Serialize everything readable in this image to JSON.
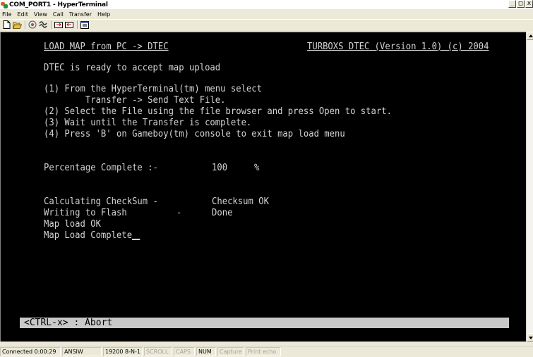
{
  "window": {
    "title": "COM_PORT1 - HyperTerminal",
    "buttons": {
      "minimize": "_",
      "maximize": "□",
      "close": "x"
    }
  },
  "menu": [
    "File",
    "Edit",
    "View",
    "Call",
    "Transfer",
    "Help"
  ],
  "toolbar": [
    "new-icon",
    "open-icon",
    "connect-icon",
    "disconnect-icon",
    "send-icon",
    "receive-icon",
    "properties-icon"
  ],
  "terminal": {
    "header_left": "LOAD MAP from PC -> DTEC",
    "header_right": "TURBOXS DTEC (Version 1.0) (c) 2004",
    "ready": "DTEC is ready to accept map upload",
    "instructions": [
      "(1) From the HyperTerminal(tm) menu select",
      "        Transfer -> Send Text File.",
      "(2) Select the File using the file browser and press Open to start.",
      "(3) Wait until the Transfer is complete.",
      "(4) Press 'B' on Gameboy(tm) console to exit map load menu"
    ],
    "progress_label": "Percentage Complete :-",
    "progress_value": "100",
    "progress_unit": "%",
    "checksum_label": "Calculating CheckSum -",
    "checksum_value": "Checksum OK",
    "flash_label": "Writing to Flash",
    "flash_dash": "-",
    "flash_value": "Done",
    "map_ok": "Map load OK",
    "map_complete": "Map Load Complete",
    "abort": "<CTRL-x> : Abort"
  },
  "status": {
    "connected": "Connected 0:00:29",
    "emulation": "ANSIW",
    "port_settings": "19200 8-N-1",
    "scroll": "SCROLL",
    "caps": "CAPS",
    "num": "NUM",
    "capture": "Capture",
    "print_echo": "Print echo"
  }
}
